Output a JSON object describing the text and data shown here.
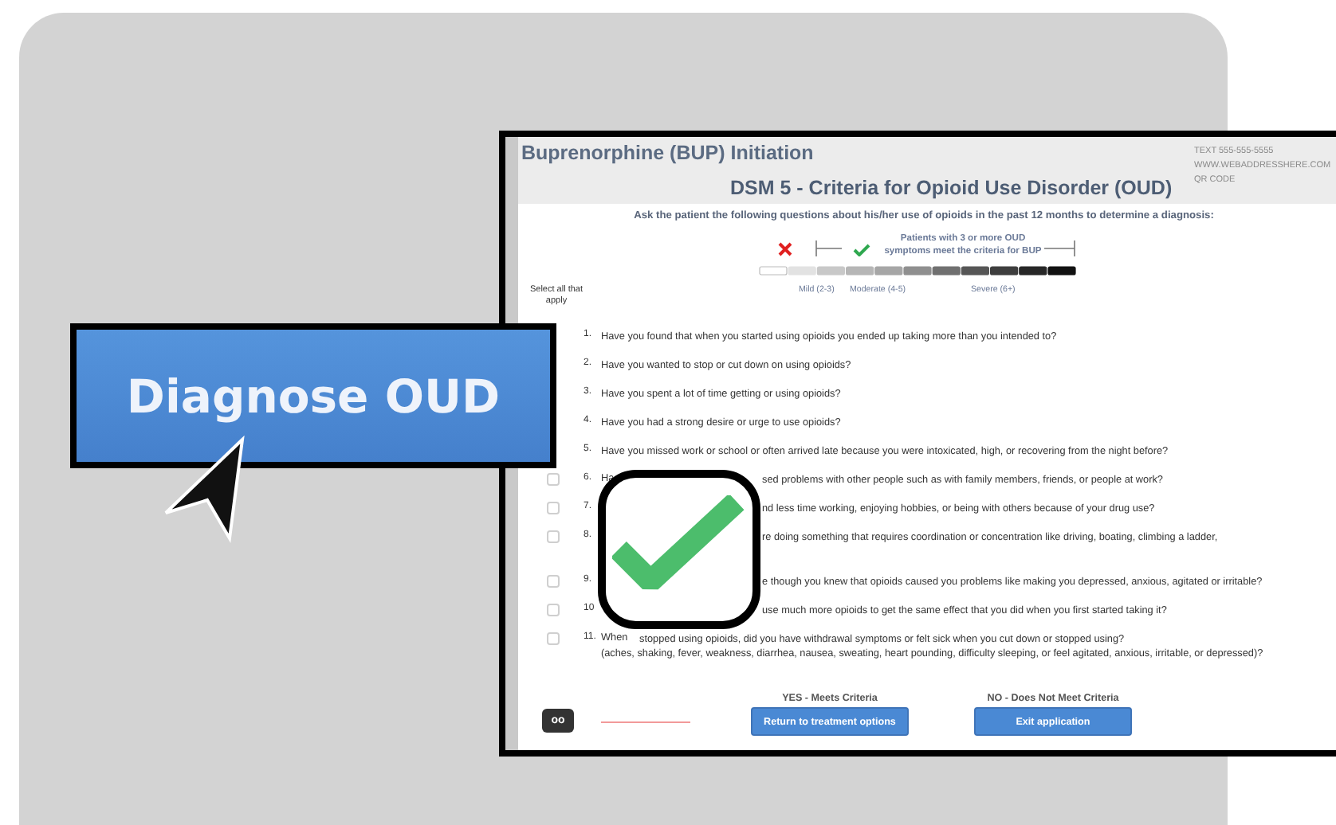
{
  "overlay_button": {
    "label": "Diagnose OUD"
  },
  "window": {
    "title": "Buprenorphine (BUP) Initiation",
    "contact": [
      "TEXT 555-555-5555",
      "WWW.WEBADDRESSHERE.COM",
      "QR CODE"
    ],
    "heading": "DSM 5 - Criteria for Opioid Use Disorder (OUD)",
    "instruction": "Ask the patient the following questions about his/her use of opioids in the past 12 months to determine a diagnosis:",
    "scale": {
      "note_lines": [
        "Patients with 3 or more OUD",
        "symptoms meet the criteria for BUP"
      ],
      "labels": [
        "Mild (2-3)",
        "Moderate (4-5)",
        "Severe (6+)"
      ]
    },
    "select_all": "Select all that apply",
    "questions": [
      {
        "kind": "plain",
        "number": "1.",
        "text": "Have you found that when you started using opioids you ended up taking more than you intended to?"
      },
      {
        "kind": "plain",
        "number": "2.",
        "text": "Have you wanted to stop or cut down on using opioids?"
      },
      {
        "kind": "plain",
        "number": "3.",
        "text": "Have you spent a lot of time getting or using opioids?"
      },
      {
        "kind": "plain",
        "number": "4.",
        "text": "Have you had a strong desire or urge to use opioids?"
      },
      {
        "kind": "plain",
        "number": "5.",
        "text": "Have you missed work or school or often arrived late because you were intoxicated, high, or recovering from the night before?"
      },
      {
        "kind": "covered",
        "checked": false,
        "number": "6.",
        "lead": "Ha",
        "text": "sed problems with other people such as with family members, friends, or people at work?"
      },
      {
        "kind": "covered",
        "checked": false,
        "number": "7.",
        "text": "nd less time working, enjoying hobbies, or being with others because of your drug use?"
      },
      {
        "kind": "covered-tall",
        "checked": false,
        "number": "8.",
        "text": "re doing something that requires coordination or concentration like driving, boating, climbing a ladder,"
      },
      {
        "kind": "covered",
        "checked": false,
        "number": "9.",
        "text": "e though you knew that opioids caused you problems like making you depressed, anxious, agitated or irritable?"
      },
      {
        "kind": "covered",
        "checked": false,
        "number": "10",
        "text": "use much more opioids to get the same effect that you did when you first started taking it?"
      },
      {
        "kind": "covered-end",
        "checked": false,
        "number": "11.",
        "lead": "When",
        "text": "stopped using opioids, did you have withdrawal symptoms or felt sick when you cut down or stopped using?",
        "second_line": "(aches, shaking, fever, weakness, diarrhea, nausea, sweating, heart pounding, difficulty sleeping, or feel agitated, anxious, irritable, or depressed)?"
      }
    ],
    "footer": {
      "badge": "oo",
      "choices": [
        {
          "label": "YES - Meets Criteria",
          "button": "Return to treatment options"
        },
        {
          "label": "NO - Does Not Meet Criteria",
          "button": "Exit application"
        }
      ]
    }
  }
}
